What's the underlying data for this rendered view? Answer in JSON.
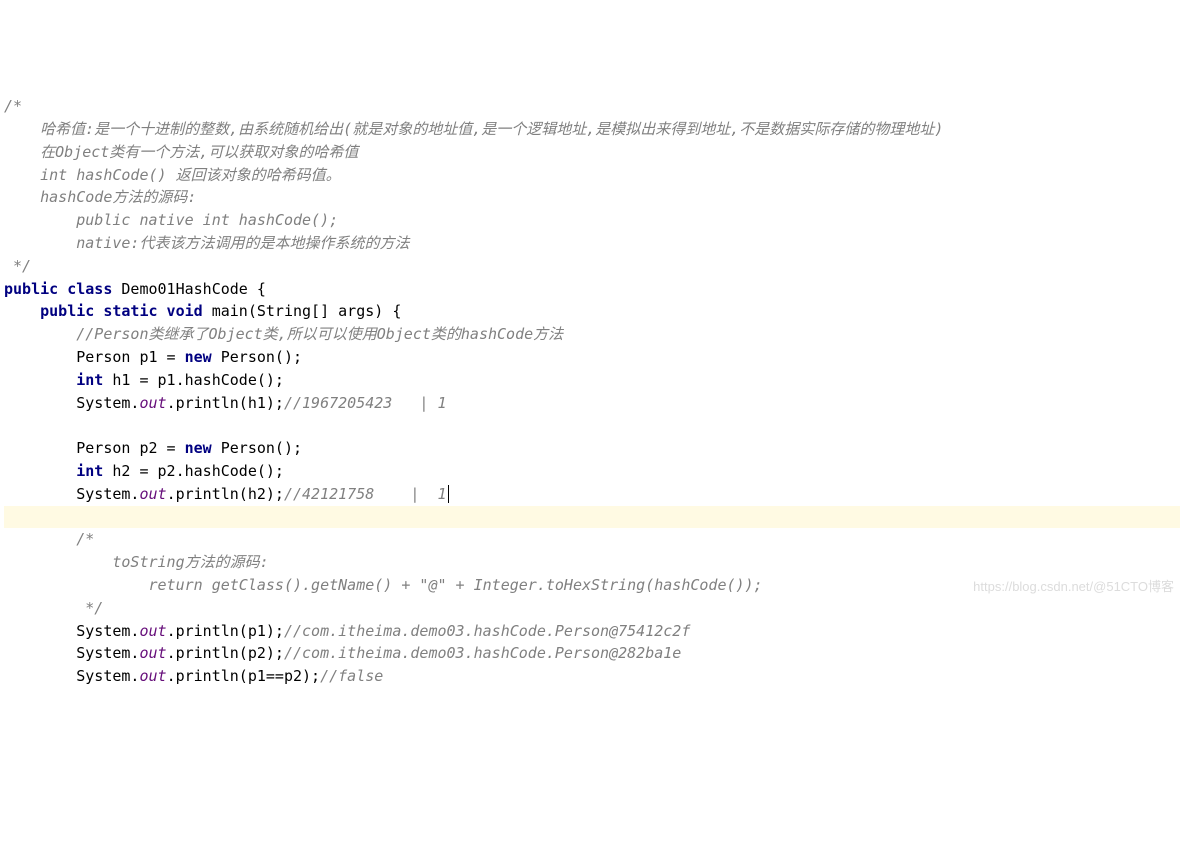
{
  "code": {
    "l01": "/*",
    "l02a": "    哈希值:是一个十进制的整数,由系统随机给出(就是对象的地址值,是一个逻辑地址,是模拟出来得到地址,不是数据实际存储的物理地址)",
    "l02b": "    在Object类有一个方法,可以获取对象的哈希值",
    "l03": "    int hashCode() 返回该对象的哈希码值。",
    "l04": "    hashCode方法的源码:",
    "l05": "        public native int hashCode();",
    "l06": "        native:代表该方法调用的是本地操作系统的方法",
    "l07": " */",
    "l08_kw1": "public class",
    "l08_name": " Demo01HashCode {",
    "l09_kw1": "public static void",
    "l09_name": " main(String[] args) {",
    "l10": "        //Person类继承了Object类,所以可以使用Object类的hashCode方法",
    "l11a": "        Person p1 = ",
    "l11_kw": "new",
    "l11b": " Person();",
    "l12_kw": "int",
    "l12b": " h1 = p1.hashCode();",
    "l13a": "        System.",
    "l13_fld": "out",
    "l13b": ".println(h1);",
    "l13c": "//1967205423   | 1",
    "l14a": "        Person p2 = ",
    "l14_kw": "new",
    "l14b": " Person();",
    "l15_kw": "int",
    "l15b": " h2 = p2.hashCode();",
    "l16a": "        System.",
    "l16_fld": "out",
    "l16b": ".println(h2);",
    "l16c": "//42121758    |  1",
    "l18": "        /*",
    "l19": "            toString方法的源码:",
    "l20a": "                return getClass().getName() + ",
    "l20_str": "\"@\"",
    "l20b": " + Integer.toHexString(hashCode());",
    "l21": "         */",
    "l22a": "        System.",
    "l22_fld": "out",
    "l22b": ".println(p1);",
    "l22c": "//com.itheima.demo03.hashCode.Person@75412c2f",
    "l23a": "        System.",
    "l23_fld": "out",
    "l23b": ".println(p2);",
    "l23c": "//com.itheima.demo03.hashCode.Person@282ba1e",
    "l24a": "        System.",
    "l24_fld": "out",
    "l24b": ".println(p1==p2);",
    "l24c": "//false"
  },
  "cursor": {
    "line": 17,
    "col": 54
  },
  "watermark": "https://blog.csdn.net/@51CTO博客"
}
